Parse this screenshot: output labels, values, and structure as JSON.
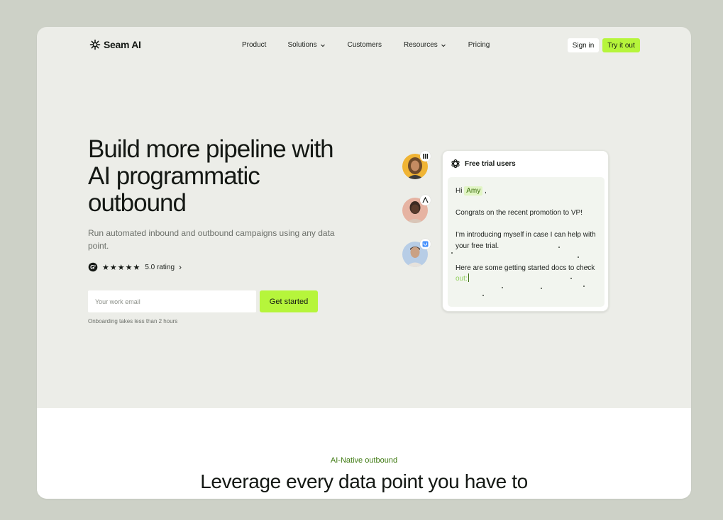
{
  "brand": {
    "name": "Seam AI",
    "accent": "#b6f53b"
  },
  "nav": {
    "links": [
      {
        "label": "Product",
        "has_dropdown": false
      },
      {
        "label": "Solutions",
        "has_dropdown": true
      },
      {
        "label": "Customers",
        "has_dropdown": false
      },
      {
        "label": "Resources",
        "has_dropdown": true
      },
      {
        "label": "Pricing",
        "has_dropdown": false
      }
    ],
    "signin_label": "Sign in",
    "try_label": "Try it out"
  },
  "hero": {
    "title_lines": [
      "Build more pipeline with",
      "AI programmatic",
      "outbound"
    ],
    "subtitle": "Run automated inbound and outbound campaigns using any data point.",
    "rating": {
      "stars": "★★★★★",
      "label": "5.0 rating",
      "value": 5.0,
      "max": 5,
      "chevron": "›"
    },
    "email_placeholder": "Your work email",
    "cta_label": "Get started",
    "note": "Onboarding takes less than 2 hours"
  },
  "card": {
    "title": "Free trial users",
    "greeting_prefix": "Hi",
    "name_token": "Amy",
    "greeting_suffix": ",",
    "line1": "Congrats on the recent promotion to VP!",
    "line2": "I'm introducing myself in case I can help with your free trial.",
    "line3_prefix": "Here are some getting started docs to check",
    "line3_typing": "out:"
  },
  "section2": {
    "eyebrow": "AI-Native outbound",
    "title": "Leverage every data point you have to"
  },
  "icons": [
    "seam-logo-icon",
    "chevron-down-icon",
    "g2-icon",
    "openai-icon",
    "company-badge-icon"
  ]
}
